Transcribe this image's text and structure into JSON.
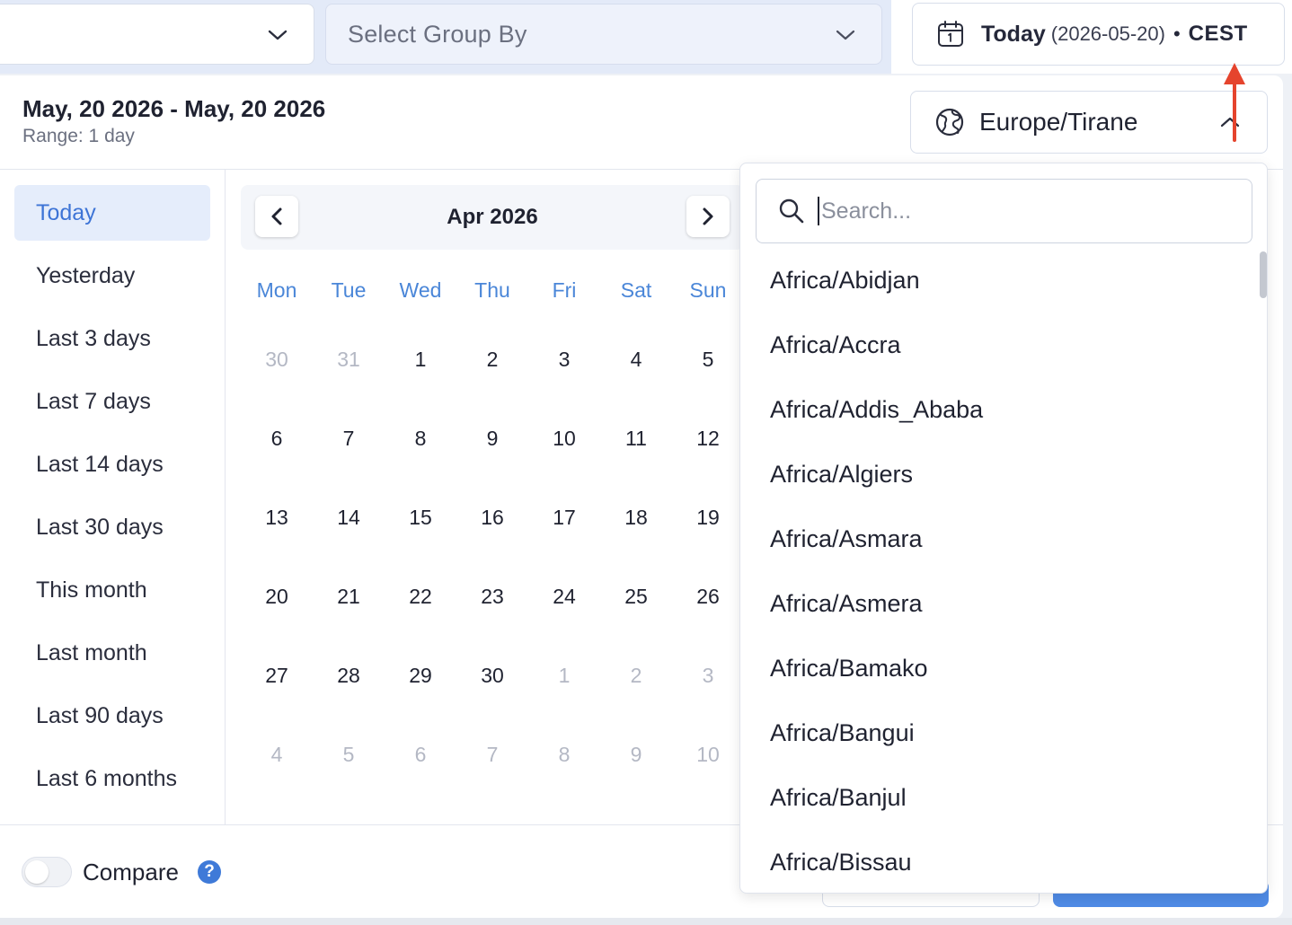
{
  "topbar": {
    "group_by_placeholder": "Select Group By",
    "date_button": {
      "main": "Today",
      "paren": "(2026-05-20)",
      "sep": "•",
      "timezone_abbr": "CEST"
    }
  },
  "panel": {
    "range_title": "May, 20 2026 - May, 20 2026",
    "range_sub": "Range: 1 day",
    "timezone_selected": "Europe/Tirane"
  },
  "presets": [
    {
      "label": "Today",
      "active": true
    },
    {
      "label": "Yesterday"
    },
    {
      "label": "Last 3 days"
    },
    {
      "label": "Last 7 days"
    },
    {
      "label": "Last 14 days"
    },
    {
      "label": "Last 30 days"
    },
    {
      "label": "This month"
    },
    {
      "label": "Last month"
    },
    {
      "label": "Last 90 days"
    },
    {
      "label": "Last 6 months"
    }
  ],
  "calendar": {
    "month_label": "Apr 2026",
    "weekdays": [
      "Mon",
      "Tue",
      "Wed",
      "Thu",
      "Fri",
      "Sat",
      "Sun"
    ],
    "weeks": [
      [
        {
          "d": "30",
          "m": true
        },
        {
          "d": "31",
          "m": true
        },
        {
          "d": "1"
        },
        {
          "d": "2"
        },
        {
          "d": "3"
        },
        {
          "d": "4"
        },
        {
          "d": "5"
        }
      ],
      [
        {
          "d": "6"
        },
        {
          "d": "7"
        },
        {
          "d": "8"
        },
        {
          "d": "9"
        },
        {
          "d": "10"
        },
        {
          "d": "11"
        },
        {
          "d": "12"
        }
      ],
      [
        {
          "d": "13"
        },
        {
          "d": "14"
        },
        {
          "d": "15"
        },
        {
          "d": "16"
        },
        {
          "d": "17"
        },
        {
          "d": "18"
        },
        {
          "d": "19"
        }
      ],
      [
        {
          "d": "20"
        },
        {
          "d": "21"
        },
        {
          "d": "22"
        },
        {
          "d": "23"
        },
        {
          "d": "24"
        },
        {
          "d": "25"
        },
        {
          "d": "26"
        }
      ],
      [
        {
          "d": "27"
        },
        {
          "d": "28"
        },
        {
          "d": "29"
        },
        {
          "d": "30"
        },
        {
          "d": "1",
          "m": true
        },
        {
          "d": "2",
          "m": true
        },
        {
          "d": "3",
          "m": true
        }
      ],
      [
        {
          "d": "4",
          "m": true
        },
        {
          "d": "5",
          "m": true
        },
        {
          "d": "6",
          "m": true
        },
        {
          "d": "7",
          "m": true
        },
        {
          "d": "8",
          "m": true
        },
        {
          "d": "9",
          "m": true
        },
        {
          "d": "10",
          "m": true
        }
      ]
    ]
  },
  "footer": {
    "compare_label": "Compare",
    "help_glyph": "?"
  },
  "tz_dropdown": {
    "search_placeholder": "Search...",
    "items": [
      "Africa/Abidjan",
      "Africa/Accra",
      "Africa/Addis_Ababa",
      "Africa/Algiers",
      "Africa/Asmara",
      "Africa/Asmera",
      "Africa/Bamako",
      "Africa/Bangui",
      "Africa/Banjul",
      "Africa/Bissau"
    ]
  },
  "colors": {
    "accent": "#3d74d6",
    "weekday": "#4a86d8",
    "annotation_arrow": "#e5442d"
  }
}
